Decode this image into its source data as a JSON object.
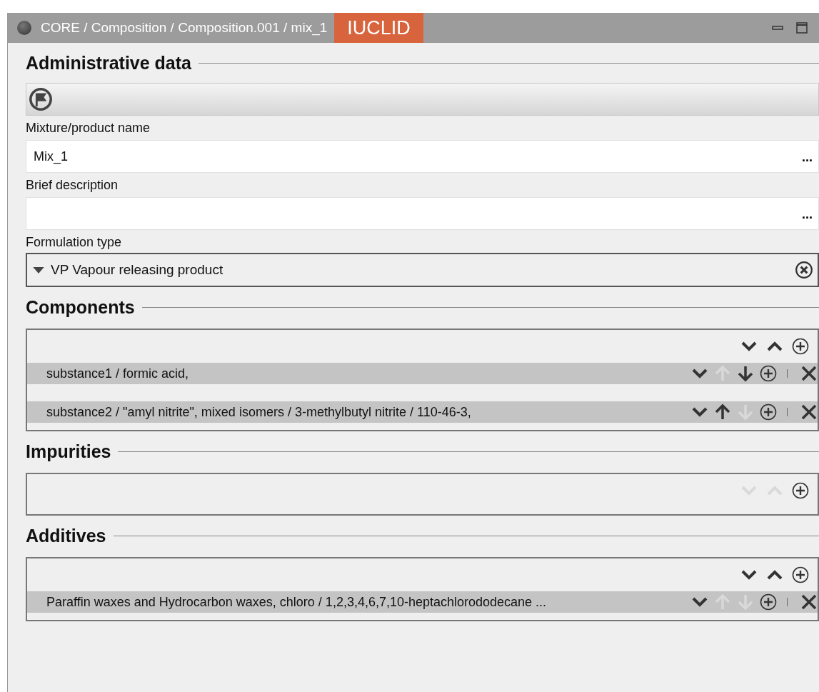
{
  "window": {
    "breadcrumb": "CORE / Composition / Composition.001 / mix_1",
    "badge": "IUCLID"
  },
  "administrative": {
    "title": "Administrative data",
    "fields": [
      {
        "kind": "text",
        "label": "Mixture/product name",
        "value": "Mix_1",
        "button": "..."
      },
      {
        "kind": "text",
        "label": "Brief description",
        "button": "..."
      },
      {
        "kind": "select",
        "label": "Formulation type",
        "value": "VP Vapour releasing product"
      }
    ]
  },
  "sections": [
    {
      "title": "Components",
      "reorder_enabled": true,
      "rows": [
        {
          "text": "substance1 / formic acid,",
          "up_enabled": false,
          "down_enabled": true
        },
        {
          "text": "substance2 / \"amyl nitrite\", mixed isomers / 3-methylbutyl nitrite / 110-46-3,",
          "up_enabled": true,
          "down_enabled": false
        }
      ]
    },
    {
      "title": "Impurities",
      "reorder_enabled": false
    },
    {
      "title": "Additives",
      "reorder_enabled": true,
      "rows": [
        {
          "text": "Paraffin waxes and Hydrocarbon waxes, chloro / 1,2,3,4,6,7,10-heptachlorododecane ...",
          "up_enabled": false,
          "down_enabled": false
        }
      ]
    }
  ]
}
